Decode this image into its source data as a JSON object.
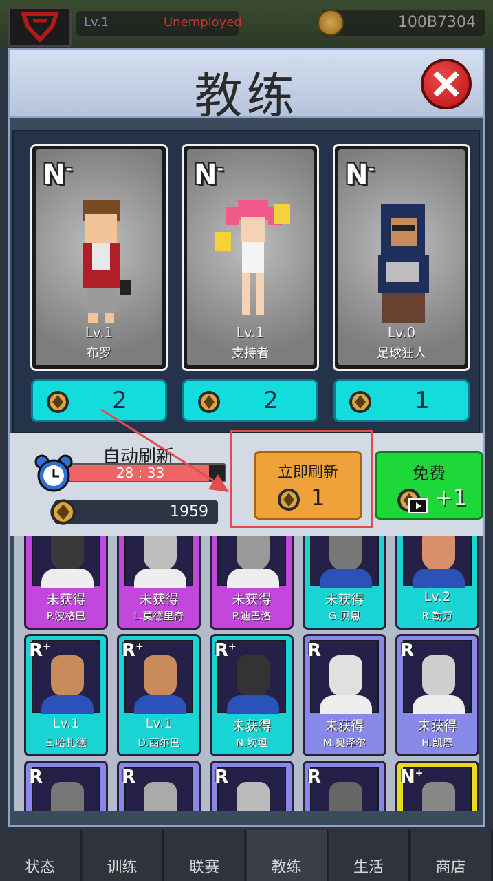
{
  "topbar": {
    "level": "Lv.1",
    "job": "Unemployed",
    "cash": "100B7304"
  },
  "modal": {
    "title": "教练"
  },
  "coaches": [
    {
      "rarity": "N",
      "rarity_suffix": "-",
      "level": "Lv.1",
      "name": "布罗",
      "cost": "2"
    },
    {
      "rarity": "N",
      "rarity_suffix": "-",
      "level": "Lv.1",
      "name": "支持者",
      "cost": "2"
    },
    {
      "rarity": "N",
      "rarity_suffix": "-",
      "level": "Lv.0",
      "name": "足球狂人",
      "cost": "1"
    }
  ],
  "refresh": {
    "auto_label": "自动刷新",
    "timer": "28 : 33",
    "timer_progress": 0.9,
    "gems": "1959",
    "now_label": "立即刷新",
    "now_cost": "1",
    "free_label": "免费",
    "free_reward": "+1"
  },
  "grid": [
    {
      "color": "purple",
      "rarity": "",
      "status": "未获得",
      "name": "P.波格巴",
      "skin": "#3a3a3a"
    },
    {
      "color": "purple",
      "rarity": "",
      "status": "未获得",
      "name": "L.莫德里奇",
      "skin": "#bdbdbd"
    },
    {
      "color": "purple",
      "rarity": "",
      "status": "未获得",
      "name": "P.迪巴洛",
      "skin": "#9a9a9a"
    },
    {
      "color": "cyan",
      "rarity": "",
      "status": "未获得",
      "name": "G.贝恩",
      "skin": "#777777"
    },
    {
      "color": "cyan",
      "rarity": "",
      "status": "Lv.2",
      "name": "R.勒万",
      "skin": "#d9906a"
    },
    {
      "color": "cyan",
      "rarity": "R",
      "rarity_suffix": "+",
      "status": "Lv.1",
      "name": "E.哈扎德",
      "skin": "#c98a5c"
    },
    {
      "color": "cyan",
      "rarity": "R",
      "rarity_suffix": "+",
      "status": "Lv.1",
      "name": "D.西尔巴",
      "skin": "#c98a5c"
    },
    {
      "color": "cyan",
      "rarity": "R",
      "rarity_suffix": "+",
      "status": "未获得",
      "name": "N.坎坦",
      "skin": "#333333"
    },
    {
      "color": "violet",
      "rarity": "R",
      "rarity_suffix": "",
      "status": "未获得",
      "name": "M.奥泽尔",
      "skin": "#e0e0e0"
    },
    {
      "color": "violet",
      "rarity": "R",
      "rarity_suffix": "",
      "status": "未获得",
      "name": "H.凯恩",
      "skin": "#cfcfcf"
    },
    {
      "color": "violet",
      "rarity": "R",
      "rarity_suffix": "",
      "status": "",
      "name": "",
      "skin": "#777777"
    },
    {
      "color": "violet",
      "rarity": "R",
      "rarity_suffix": "",
      "status": "",
      "name": "",
      "skin": "#aaaaaa"
    },
    {
      "color": "violet",
      "rarity": "R",
      "rarity_suffix": "",
      "status": "",
      "name": "",
      "skin": "#bbbbbb"
    },
    {
      "color": "violet",
      "rarity": "R",
      "rarity_suffix": "",
      "status": "",
      "name": "",
      "skin": "#666666"
    },
    {
      "color": "yellow",
      "rarity": "N",
      "rarity_suffix": "+",
      "status": "",
      "name": "",
      "skin": "#888888"
    }
  ],
  "tabs": [
    "状态",
    "训练",
    "联赛",
    "教练",
    "生活",
    "商店"
  ],
  "active_tab": 3,
  "colors": {
    "cyan_button": "#12dcdc",
    "orange_button": "#f0a23a",
    "green_button": "#1ed83a",
    "highlight": "#e24c4c"
  }
}
